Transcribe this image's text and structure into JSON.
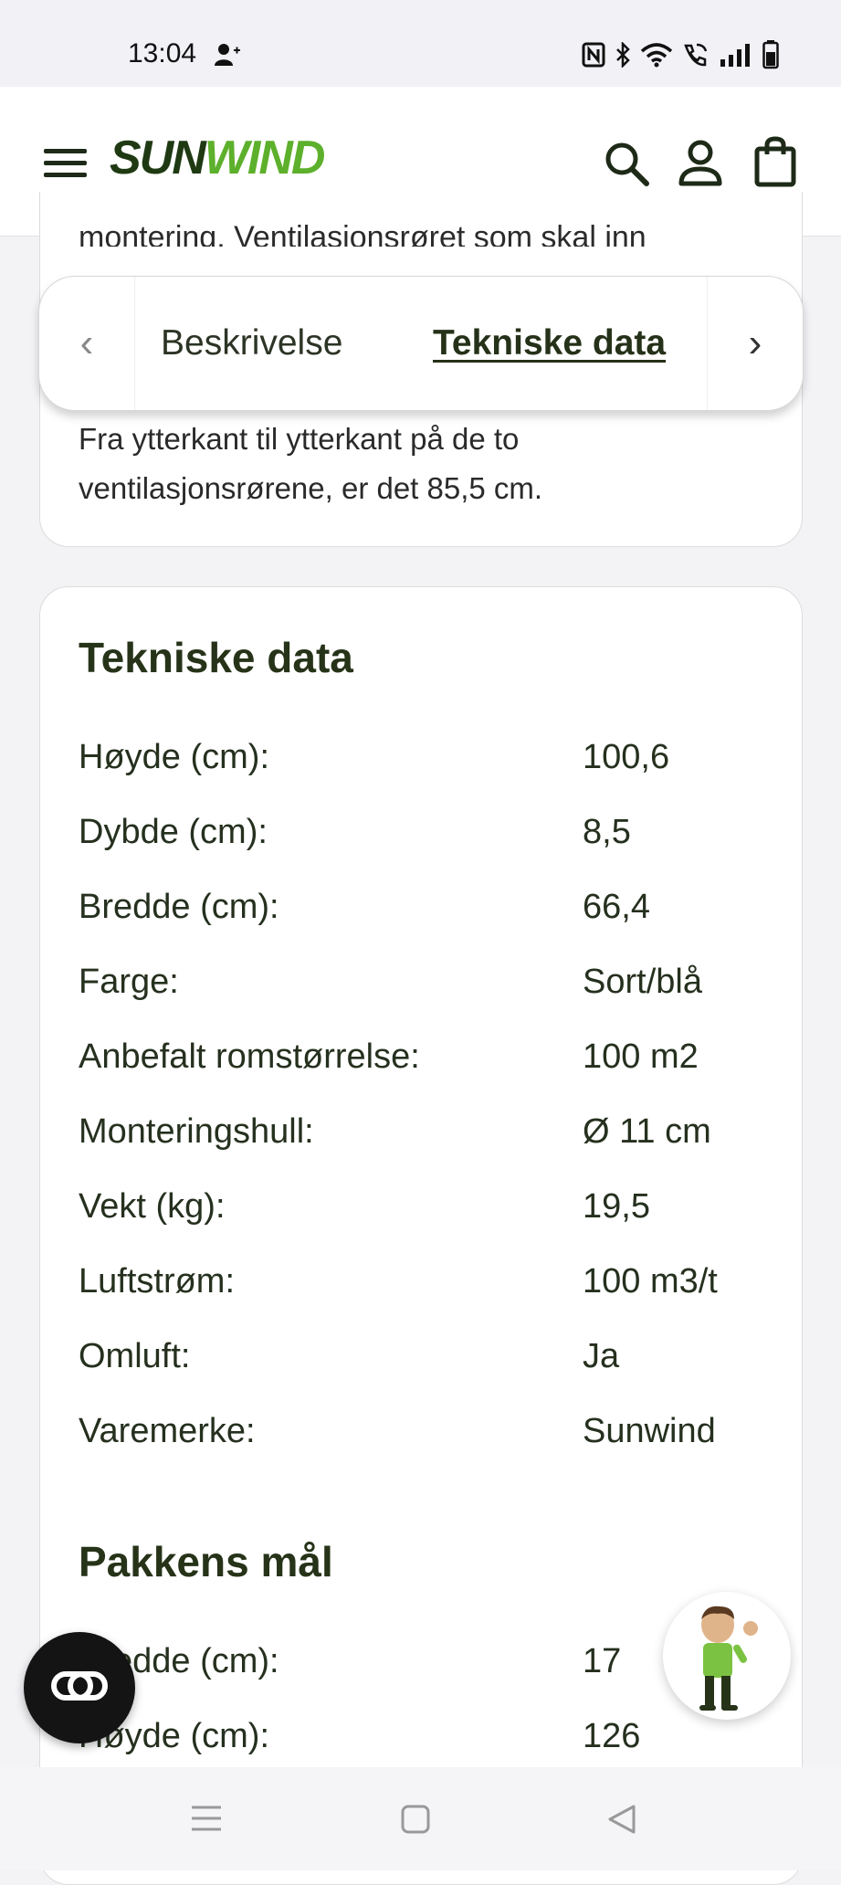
{
  "status": {
    "time": "13:04",
    "icons": [
      "person-add-icon",
      "nfc-icon",
      "bluetooth-icon",
      "wifi-icon",
      "wifi-calling-icon",
      "signal-icon",
      "battery-icon"
    ]
  },
  "header": {
    "logo_text_1": "SUN",
    "logo_text_2": "WIND",
    "icons": [
      "menu-icon",
      "search-icon",
      "account-icon",
      "cart-icon"
    ]
  },
  "description": {
    "truncated_line": "montering. Ventilasjonsrøret som skal inn",
    "intro": "Fra ytterkant til ytterkant på de to ventilasjonsrørene, er det 85,5 cm."
  },
  "tabs": {
    "items": [
      {
        "label": "Beskrivelse"
      },
      {
        "label": "Tekniske data"
      }
    ],
    "active": "Tekniske data"
  },
  "tech": {
    "title": "Tekniske data",
    "rows": [
      {
        "key": "Høyde (cm):",
        "value": "100,6"
      },
      {
        "key": "Dybde (cm):",
        "value": "8,5"
      },
      {
        "key": "Bredde (cm):",
        "value": "66,4"
      },
      {
        "key": "Farge:",
        "value": "Sort/blå"
      },
      {
        "key": "Anbefalt romstørrelse:",
        "value": "100 m2"
      },
      {
        "key": "Monteringshull:",
        "value": "Ø 11 cm"
      },
      {
        "key": "Vekt (kg):",
        "value": "19,5"
      },
      {
        "key": "Luftstrøm:",
        "value": "100 m3/t"
      },
      {
        "key": "Omluft:",
        "value": "Ja"
      },
      {
        "key": "Varemerke:",
        "value": "Sunwind"
      }
    ]
  },
  "package": {
    "title": "Pakkens mål",
    "rows": [
      {
        "key": "Bredde (cm):",
        "value": "17"
      },
      {
        "key": "Høyde (cm):",
        "value": "126"
      }
    ]
  },
  "colors": {
    "brand_dark": "#1f3a13",
    "brand_green": "#5db02b",
    "text": "#25301e"
  }
}
